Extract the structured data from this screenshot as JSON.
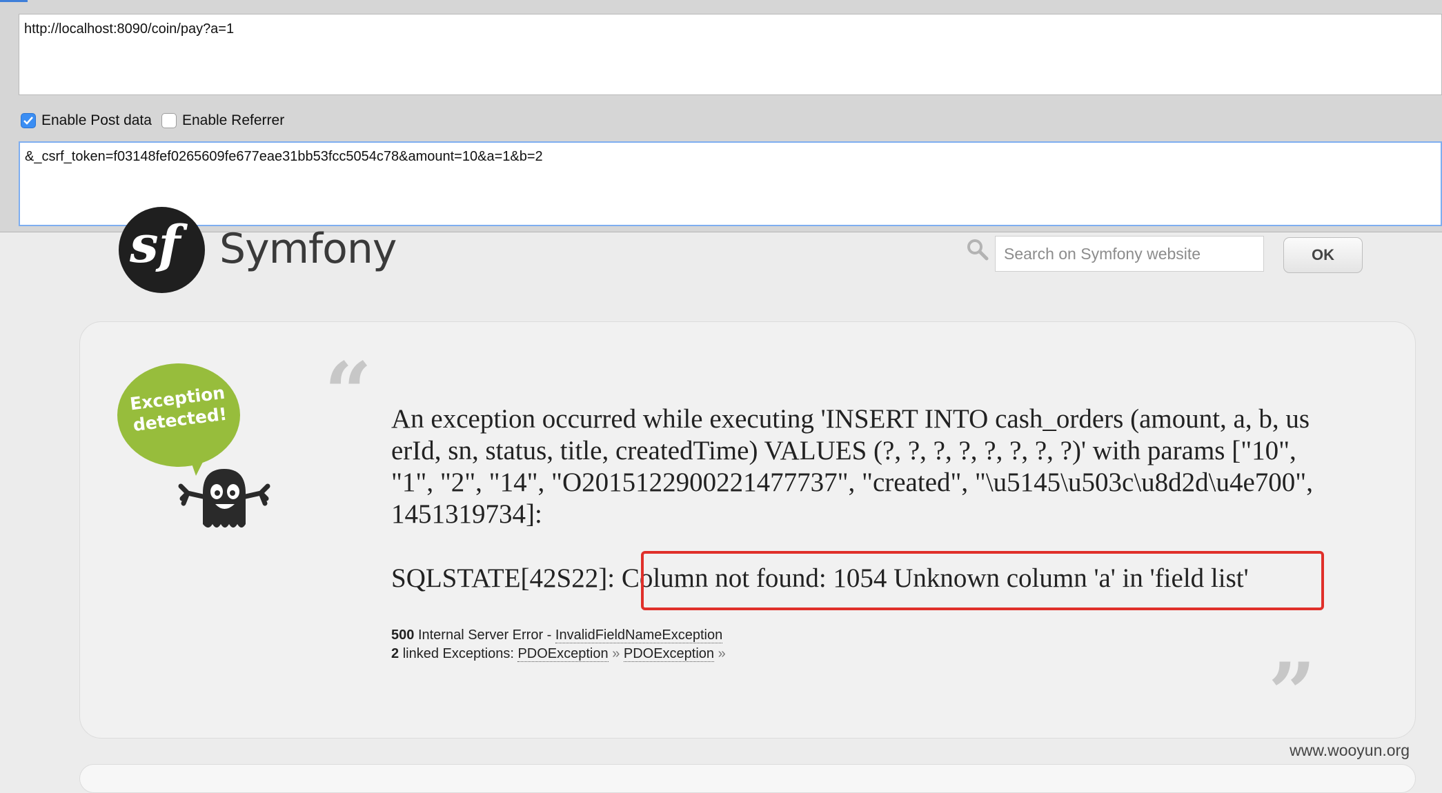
{
  "request": {
    "url": "http://localhost:8090/coin/pay?a=1",
    "enable_post_label": "Enable Post data",
    "enable_post_checked": true,
    "enable_referrer_label": "Enable Referrer",
    "enable_referrer_checked": false,
    "post_data": "&_csrf_token=f03148fef0265609fe677eae31bb53fcc5054c78&amount=10&a=1&b=2"
  },
  "header": {
    "logo_glyph": "sf",
    "brand": "Symfony",
    "search_placeholder": "Search on Symfony website",
    "ok_label": "OK"
  },
  "exception": {
    "bubble_text_line1": "Exception",
    "bubble_text_line2": "detected!",
    "message": "An exception occurred while executing 'INSERT INTO cash_orders (amount, a, b, userId, sn, status, title, createdTime) VALUES (?, ?, ?, ?, ?, ?, ?, ?)' with params [\"10\", \"1\", \"2\", \"14\", \"O2015122900221477737\", \"created\", \"\\u5145\\u503c\\u8d2d\\u4e700\", 1451319734]:",
    "sqlstate_prefix": "SQLSTATE[42S22]: ",
    "sqlstate_message": "Column not found: 1054 Unknown column 'a' in 'field list'",
    "status_code": "500",
    "status_text": "Internal Server Error - ",
    "exception_class": "InvalidFieldNameException",
    "linked_count": "2",
    "linked_text": "linked Exceptions: ",
    "linked_1": "PDOException",
    "linked_2": "PDOException",
    "raquo": "»"
  },
  "watermark": "www.wooyun.org",
  "colors": {
    "highlight": "#e0302a",
    "bubble": "#97bd3c",
    "checkbox": "#3b8ef3"
  }
}
